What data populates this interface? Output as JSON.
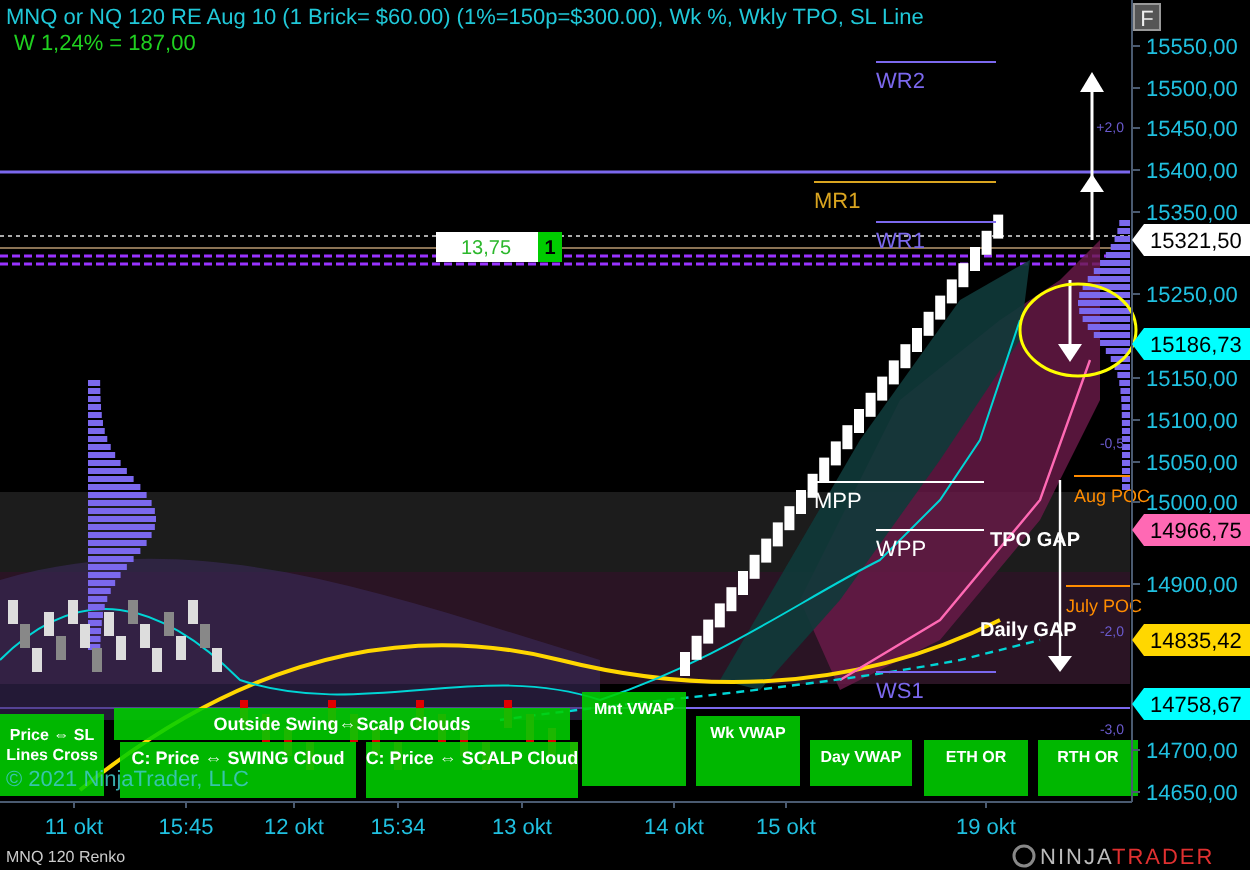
{
  "header": {
    "title": "MNQ or NQ 120 RE Aug 10 (1 Brick= $60.00) (1%=150p=$300.00), Wk %, Wkly TPO, SL Line",
    "subtitle": "W 1,24% = 187,00"
  },
  "panel_button": "F",
  "price_axis": {
    "ticks": [
      "15550,00",
      "15500,00",
      "15450,00",
      "15400,00",
      "15350,00",
      "15250,00",
      "15150,00",
      "15100,00",
      "15050,00",
      "15000,00",
      "14900,00",
      "14700,00",
      "14650,00"
    ]
  },
  "time_axis": {
    "ticks": [
      "11 okt",
      "15:45",
      "12 okt",
      "15:34",
      "13 okt",
      "14 okt",
      "15 okt",
      "19 okt"
    ]
  },
  "price_flags": [
    {
      "text": "15321,50",
      "color": "#ffffff"
    },
    {
      "text": "15186,73",
      "color": "#00ffff"
    },
    {
      "text": "14966,75",
      "color": "#ff69b4"
    },
    {
      "text": "14835,42",
      "color": "#ffd700"
    },
    {
      "text": "14758,67",
      "color": "#00ffff"
    }
  ],
  "level_labels": [
    {
      "text": "WR2",
      "color": "#7b68ee"
    },
    {
      "text": "MR1",
      "color": "#daa520"
    },
    {
      "text": "WR1",
      "color": "#7b68ee"
    },
    {
      "text": "MPP",
      "color": "#ffffff"
    },
    {
      "text": "WPP",
      "color": "#ffffff"
    },
    {
      "text": "WS1",
      "color": "#7b68ee"
    },
    {
      "text": "Aug POC",
      "color": "#ff8c00"
    },
    {
      "text": "July POC",
      "color": "#ff8c00"
    }
  ],
  "gap_labels": [
    "TPO GAP",
    "Daily GAP"
  ],
  "deviation_labels": [
    "+2,0",
    "-0,5",
    "-2,0",
    "-3,0"
  ],
  "position": {
    "value": "13,75",
    "quantity": "1"
  },
  "indicator_labels": [
    "Price ⇔ SL Lines Cross",
    "Outside Swing⇔Scalp Clouds",
    "C: Price ⇔ SWING Cloud",
    "C: Price ⇔ SCALP Cloud",
    "Mnt VWAP",
    "Wk VWAP",
    "Day VWAP",
    "ETH OR",
    "RTH OR"
  ],
  "footer": {
    "copyright": "© 2021 NinjaTrader, LLC",
    "instrument": "MNQ 120 Renko",
    "brand": [
      "NINJA",
      "TRADER"
    ]
  }
}
